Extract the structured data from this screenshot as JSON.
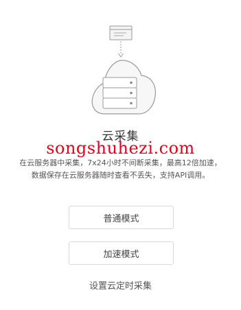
{
  "illustration": {
    "document_icon": "document-icon",
    "cloud_icon": "cloud-icon",
    "server_icon": "server-stack-icon",
    "stroke_color": "#999999",
    "fill_color": "#f7f7f7"
  },
  "title": "云采集",
  "watermark": "songshuhezi.com",
  "description_line1": "在云服务器中采集，7x24小时不间断采集，最高12倍加速，",
  "description_line2": "数据保存在云服务器随时查看不丢失，支持API调用。",
  "buttons": {
    "normal_mode": "普通模式",
    "fast_mode": "加速模式"
  },
  "schedule_link": "设置云定时采集",
  "colors": {
    "watermark": "#e0001b",
    "border": "#d8d8d8",
    "text": "#333333"
  }
}
